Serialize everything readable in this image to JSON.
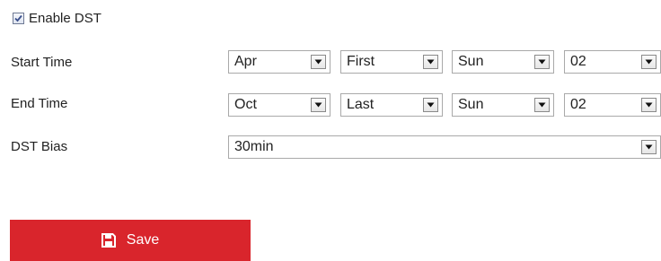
{
  "enable_dst": {
    "label": "Enable DST",
    "checked": true
  },
  "start_time": {
    "label": "Start Time",
    "month": "Apr",
    "week": "First",
    "day": "Sun",
    "hour": "02"
  },
  "end_time": {
    "label": "End Time",
    "month": "Oct",
    "week": "Last",
    "day": "Sun",
    "hour": "02"
  },
  "dst_bias": {
    "label": "DST Bias",
    "value": "30min"
  },
  "save_button": {
    "label": "Save",
    "icon": "floppy-disk-icon",
    "color": "#d9252c"
  }
}
